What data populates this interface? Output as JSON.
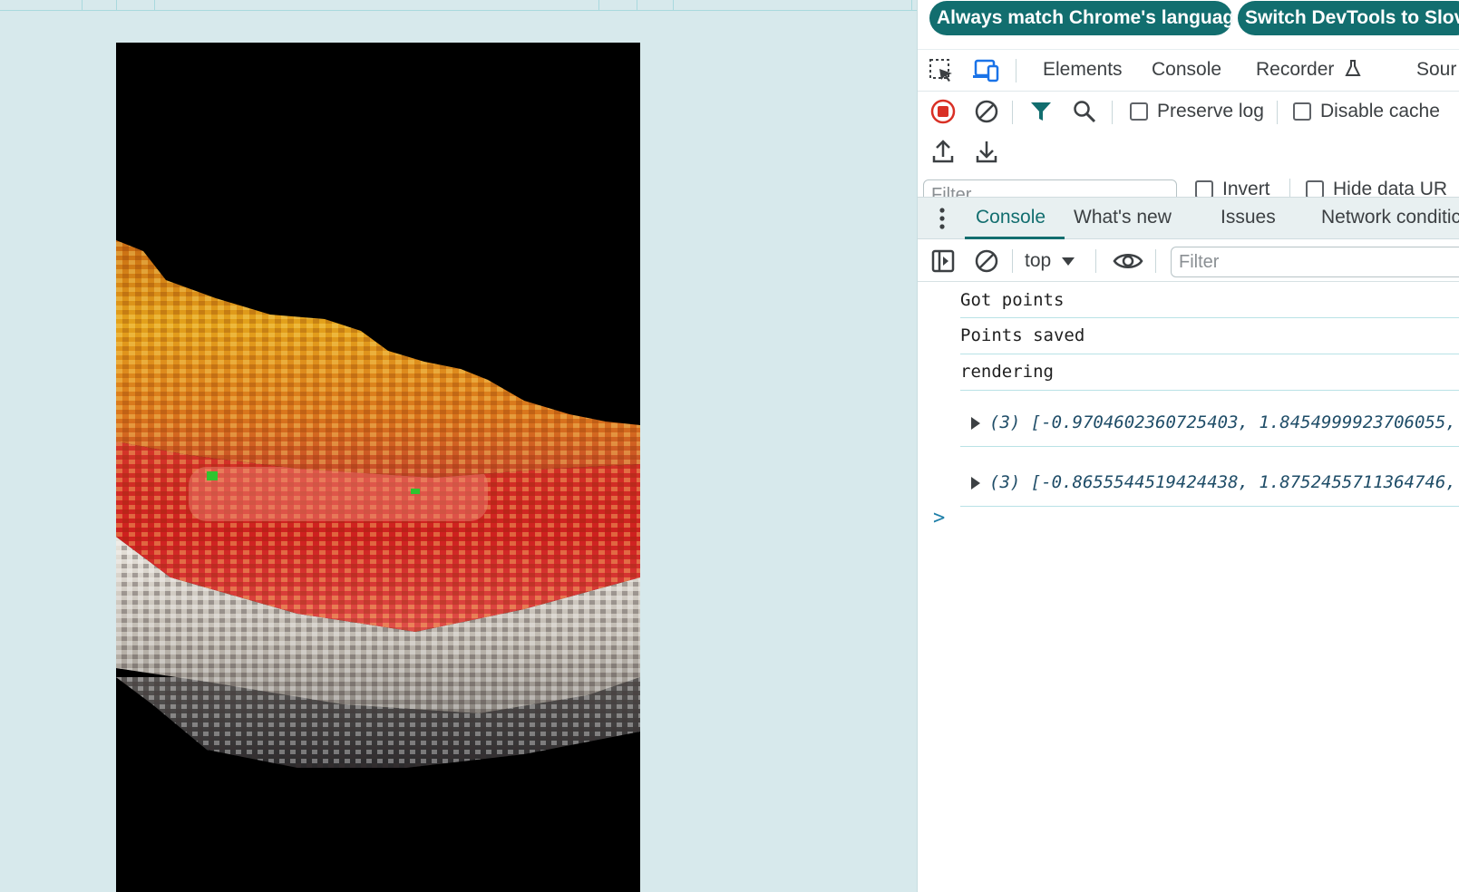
{
  "banner": {
    "language_button": "Always match Chrome's language",
    "switch_button": "Switch DevTools to Slove"
  },
  "main_tabs": {
    "elements": "Elements",
    "console": "Console",
    "recorder": "Recorder",
    "sources": "Sour"
  },
  "network_toolbar": {
    "preserve_log": "Preserve log",
    "disable_cache": "Disable cache"
  },
  "network_filter": {
    "placeholder": "Filter",
    "invert": "Invert",
    "hide_data_urls": "Hide data UR"
  },
  "drawer_tabs": {
    "console": "Console",
    "whats_new": "What's new",
    "issues": "Issues",
    "network_conditions": "Network conditic"
  },
  "console_toolbar": {
    "context": "top",
    "filter_placeholder": "Filter"
  },
  "console": {
    "messages": [
      "Got points",
      "Points saved",
      "rendering"
    ],
    "arrays": [
      "(3) [-0.9704602360725403, 1.8454999923706055,",
      "(3) [-0.8655544519424438, 1.8752455711364746,"
    ],
    "prompt": ">"
  },
  "colors": {
    "accent": "#126e6f",
    "page_background": "#d7e9ec",
    "record_red": "#d93025"
  }
}
